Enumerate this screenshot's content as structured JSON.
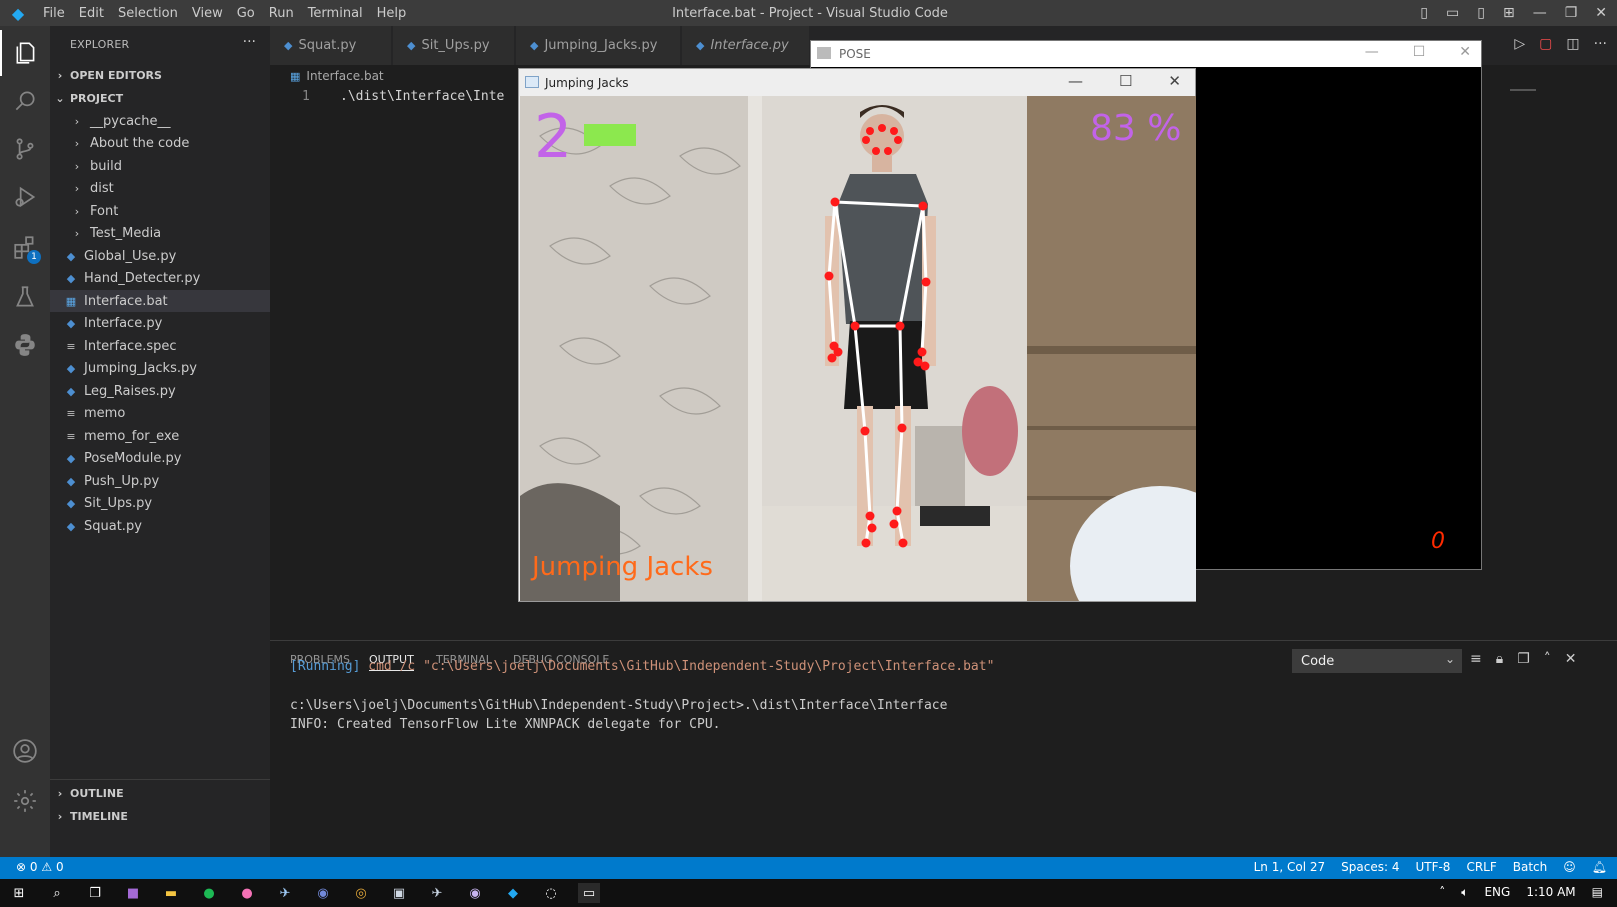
{
  "titlebar": {
    "menu": [
      "File",
      "Edit",
      "Selection",
      "View",
      "Go",
      "Run",
      "Terminal",
      "Help"
    ],
    "window_title": "Interface.bat - Project - Visual Studio Code"
  },
  "activity": {
    "extensions_badge": "1"
  },
  "sidebar": {
    "title": "EXPLORER",
    "open_editors": "OPEN EDITORS",
    "project": "PROJECT",
    "folders": [
      "__pycache__",
      "About the code",
      "build",
      "dist",
      "Font",
      "Test_Media"
    ],
    "files": [
      {
        "name": "Global_Use.py",
        "icon": "python-file-icon"
      },
      {
        "name": "Hand_Detecter.py",
        "icon": "python-file-icon"
      },
      {
        "name": "Interface.bat",
        "icon": "windows-bat-icon"
      },
      {
        "name": "Interface.py",
        "icon": "python-file-icon"
      },
      {
        "name": "Interface.spec",
        "icon": "text-file-icon"
      },
      {
        "name": "Jumping_Jacks.py",
        "icon": "python-file-icon"
      },
      {
        "name": "Leg_Raises.py",
        "icon": "python-file-icon"
      },
      {
        "name": "memo",
        "icon": "text-file-icon"
      },
      {
        "name": "memo_for_exe",
        "icon": "text-file-icon"
      },
      {
        "name": "PoseModule.py",
        "icon": "python-file-icon"
      },
      {
        "name": "Push_Up.py",
        "icon": "python-file-icon"
      },
      {
        "name": "Sit_Ups.py",
        "icon": "python-file-icon"
      },
      {
        "name": "Squat.py",
        "icon": "python-file-icon"
      }
    ],
    "selected": "Interface.bat",
    "outline": "OUTLINE",
    "timeline": "TIMELINE"
  },
  "tabs": [
    "Squat.py",
    "Sit_Ups.py",
    "Jumping_Jacks.py",
    "Interface.py"
  ],
  "breadcrumb": "Interface.bat",
  "editor": {
    "line_number": "1",
    "line_text": ".\\dist\\Interface\\Inte"
  },
  "pose_window": {
    "title": "POSE",
    "counter": "0"
  },
  "jj_window": {
    "title": "Jumping Jacks",
    "reps": "2",
    "percent": "83 %",
    "exercise_label": "Jumping Jacks"
  },
  "panel": {
    "tabs": [
      "PROBLEMS",
      "OUTPUT",
      "TERMINAL",
      "DEBUG CONSOLE"
    ],
    "active_tab": "OUTPUT",
    "channel": "Code",
    "running_tag": "[Running]",
    "running_cmd": "cmd /c \"c:\\Users\\joelj\\Documents\\GitHub\\Independent-Study\\Project\\Interface.bat\"",
    "line2": "c:\\Users\\joelj\\Documents\\GitHub\\Independent-Study\\Project>.\\dist\\Interface\\Interface",
    "line3": "INFO: Created TensorFlow Lite XNNPACK delegate for CPU."
  },
  "statusbar": {
    "errors": "0",
    "warnings": "0",
    "position": "Ln 1, Col 27",
    "spaces": "Spaces: 4",
    "encoding": "UTF-8",
    "eol": "CRLF",
    "language": "Batch"
  },
  "taskbar": {
    "lang": "ENG",
    "time": "1:10 AM"
  },
  "colors": {
    "accent": "#007acc",
    "rep_color": "#c263e8",
    "label_color": "#ff6a1a",
    "joint": "#ff1a1a"
  }
}
